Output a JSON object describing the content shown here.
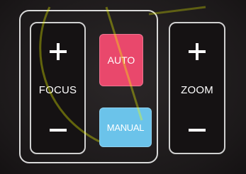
{
  "remote_panel": {
    "focus": {
      "increase_icon": "plus-icon",
      "decrease_icon": "minus-icon",
      "label": "FOCUS"
    },
    "zoom": {
      "increase_icon": "plus-icon",
      "decrease_icon": "minus-icon",
      "label": "ZOOM"
    },
    "auto_button": {
      "label": "AUTO",
      "color": "#e9486c"
    },
    "manual_button": {
      "label": "MANUAL",
      "color": "#6bc3ea"
    },
    "frame_color": "#d9d9d9",
    "background_color": "#231f20"
  }
}
